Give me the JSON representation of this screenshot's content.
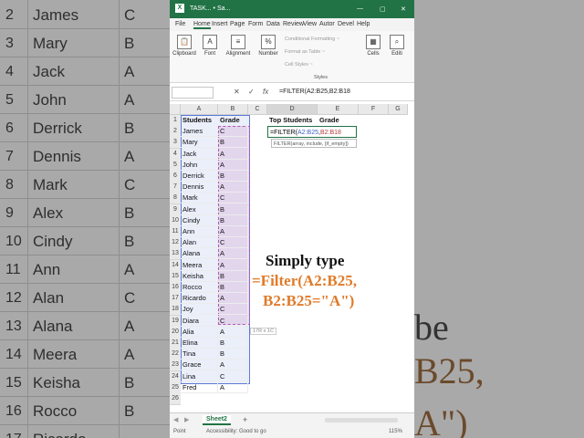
{
  "background_left": [
    {
      "row": "2",
      "name": "James",
      "grade": "C"
    },
    {
      "row": "3",
      "name": "Mary",
      "grade": "B"
    },
    {
      "row": "4",
      "name": "Jack",
      "grade": "A"
    },
    {
      "row": "5",
      "name": "John",
      "grade": "A"
    },
    {
      "row": "6",
      "name": "Derrick",
      "grade": "B"
    },
    {
      "row": "7",
      "name": "Dennis",
      "grade": "A"
    },
    {
      "row": "8",
      "name": "Mark",
      "grade": "C"
    },
    {
      "row": "9",
      "name": "Alex",
      "grade": "B"
    },
    {
      "row": "10",
      "name": "Cindy",
      "grade": "B"
    },
    {
      "row": "11",
      "name": "Ann",
      "grade": "A"
    },
    {
      "row": "12",
      "name": "Alan",
      "grade": "C"
    },
    {
      "row": "13",
      "name": "Alana",
      "grade": "A"
    },
    {
      "row": "14",
      "name": "Meera",
      "grade": "A"
    },
    {
      "row": "15",
      "name": "Keisha",
      "grade": "B"
    },
    {
      "row": "16",
      "name": "Rocco",
      "grade": "B"
    },
    {
      "row": "17",
      "name": "Ricardo",
      "grade": ""
    }
  ],
  "background_right": {
    "line1": "be",
    "line2": "B25,",
    "line3": "A\")"
  },
  "titlebar": {
    "title": "TASK... • Sa...",
    "minimize": "—",
    "restore": "▢",
    "close": "✕",
    "icon": "excel-logo"
  },
  "tabs": [
    "File",
    "Home",
    "Insert",
    "Page",
    "Form",
    "Data",
    "Review",
    "View",
    "Autor",
    "Devel",
    "Help"
  ],
  "ribbon": {
    "groups": [
      "Clipboard",
      "Font",
      "Alignment",
      "Number",
      "Cells",
      "Editi"
    ],
    "styles_items": [
      "Conditional Formatting ~",
      "Format as Table ~",
      "Cell Styles ~"
    ],
    "styles_label": "Styles"
  },
  "formula_bar": {
    "name_box": "",
    "cancel": "✕",
    "enter": "✓",
    "fx": "fx",
    "formula": "=FILTER(A2:B25,B2:B18"
  },
  "columns": [
    "A",
    "B",
    "C",
    "D",
    "E",
    "F",
    "G"
  ],
  "headers": {
    "A": "Students",
    "B": "Grade",
    "D": "Top Students",
    "E": "Grade"
  },
  "rows": [
    {
      "n": "1"
    },
    {
      "n": "2",
      "name": "James",
      "grade": "C"
    },
    {
      "n": "3",
      "name": "Mary",
      "grade": "B"
    },
    {
      "n": "4",
      "name": "Jack",
      "grade": "A"
    },
    {
      "n": "5",
      "name": "John",
      "grade": "A"
    },
    {
      "n": "6",
      "name": "Derrick",
      "grade": "B"
    },
    {
      "n": "7",
      "name": "Dennis",
      "grade": "A"
    },
    {
      "n": "8",
      "name": "Mark",
      "grade": "C"
    },
    {
      "n": "9",
      "name": "Alex",
      "grade": "B"
    },
    {
      "n": "10",
      "name": "Cindy",
      "grade": "B"
    },
    {
      "n": "11",
      "name": "Ann",
      "grade": "A"
    },
    {
      "n": "12",
      "name": "Alan",
      "grade": "C"
    },
    {
      "n": "13",
      "name": "Alana",
      "grade": "A"
    },
    {
      "n": "14",
      "name": "Meera",
      "grade": "A"
    },
    {
      "n": "15",
      "name": "Keisha",
      "grade": "B"
    },
    {
      "n": "16",
      "name": "Rocco",
      "grade": "B"
    },
    {
      "n": "17",
      "name": "Ricardo",
      "grade": "A"
    },
    {
      "n": "18",
      "name": "Joy",
      "grade": "C"
    },
    {
      "n": "19",
      "name": "Diara",
      "grade": "C"
    },
    {
      "n": "20",
      "name": "Alia",
      "grade": "A"
    },
    {
      "n": "21",
      "name": "Elina",
      "grade": "B"
    },
    {
      "n": "22",
      "name": "Tina",
      "grade": "B"
    },
    {
      "n": "23",
      "name": "Grace",
      "grade": "A"
    },
    {
      "n": "24",
      "name": "Lina",
      "grade": "C"
    },
    {
      "n": "25",
      "name": "Fred",
      "grade": "A"
    },
    {
      "n": "26"
    }
  ],
  "active_cell": {
    "formula_start": "=FILTER(",
    "arg1": "A2:B25",
    "comma": ",",
    "arg2": "B2:B18"
  },
  "tooltip": "FILTER(array, include, [if_empty])",
  "size_chip": "17R x 1C",
  "overlay": {
    "line1": "Simply type",
    "line2": "=Filter(A2:B25,",
    "line3": "B2:B25=\"A\")"
  },
  "sheet_tab": "Sheet2",
  "add_sheet": "+",
  "status": {
    "mode": "Point",
    "accessibility": "Accessibility: Good to go",
    "zoom": "115%"
  },
  "colors": {
    "excel_green": "#217346",
    "overlay_orange": "#e07b2a",
    "arg1_blue": "#3b63c4",
    "arg2_red": "#b23a3a"
  }
}
